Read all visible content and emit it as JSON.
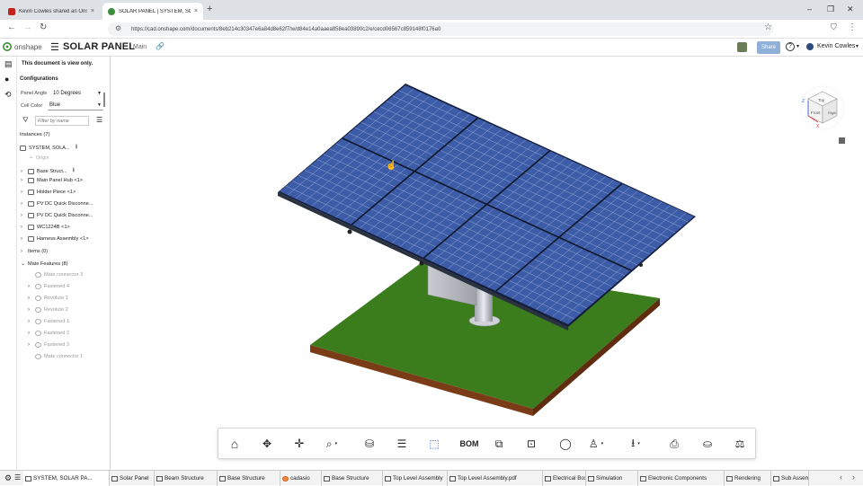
{
  "browser": {
    "tabs": [
      {
        "title": "Kevin Cowles shared an Onshape",
        "close": "×"
      },
      {
        "title": "SOLAR PANEL | SYSTEM, SOLAR",
        "close": "×"
      }
    ],
    "new_tab": "+",
    "window_controls": [
      "–",
      "❐",
      "✕"
    ],
    "url": "https://cad.onshape.com/documents/8eb214c30347e6a84d8e62f7/w/d84e14a0aaea858ea03890c2/e/cecd06567c859148f0176a0"
  },
  "app": {
    "logo_text": "onshape",
    "doc_title": "SOLAR PANEL",
    "branch": "Main",
    "share_label": "Share",
    "help_label": "?",
    "user_name": "Kevin Cowles",
    "accent": "#1c6fd1"
  },
  "panel": {
    "notice": "This document is view only.",
    "configurations_title": "Configurations",
    "panel_angle_label": "Panel Angle",
    "panel_angle_value": "10 Degrees",
    "cell_color_label": "Cell Color",
    "cell_color_value": "Blue",
    "filter_placeholder": "Filter by name",
    "instances_title": "Instances (7)",
    "root_name": "SYSTEM, SOLA...",
    "origin": "Origin",
    "instances": [
      "Base Struct...",
      "Main Panel Hub <1>",
      "Holder Piece <1>",
      "PV DC Quick Disconne...",
      "PV DC Quick Disconne...",
      "WC1224B <1>",
      "Harness Assembly <1>"
    ],
    "items_title": "Items (0)",
    "mate_features_title": "Mate Features (8)",
    "mates": [
      "Mate connector 3",
      "Fastened 4",
      "Revolute 1",
      "Revolute 2",
      "Fastened 1",
      "Fastened 2",
      "Fastened 3",
      "Mate connector 1"
    ]
  },
  "viewcube": {
    "top": "Top",
    "front": "Front",
    "right": "Right",
    "z": "Z",
    "x": "X"
  },
  "toolbar": {
    "bom_label": "BOM"
  },
  "bottom_tabs": [
    "SYSTEM, SOLAR PA...",
    "Solar Panel",
    "Beam Structure",
    "Base Structure",
    "cadasio",
    "Base Structure",
    "Top Level Assembly",
    "Top Level Assembly.pdf",
    "Electrical Box",
    "Simulation",
    "Electronic Components",
    "Rendering",
    "Sub Assem"
  ],
  "colors": {
    "panel_cell": "#3d5ca8",
    "grid_line": "#9db1dc",
    "ground_top": "#3b7d1d",
    "ground_side": "#7a3c16"
  }
}
